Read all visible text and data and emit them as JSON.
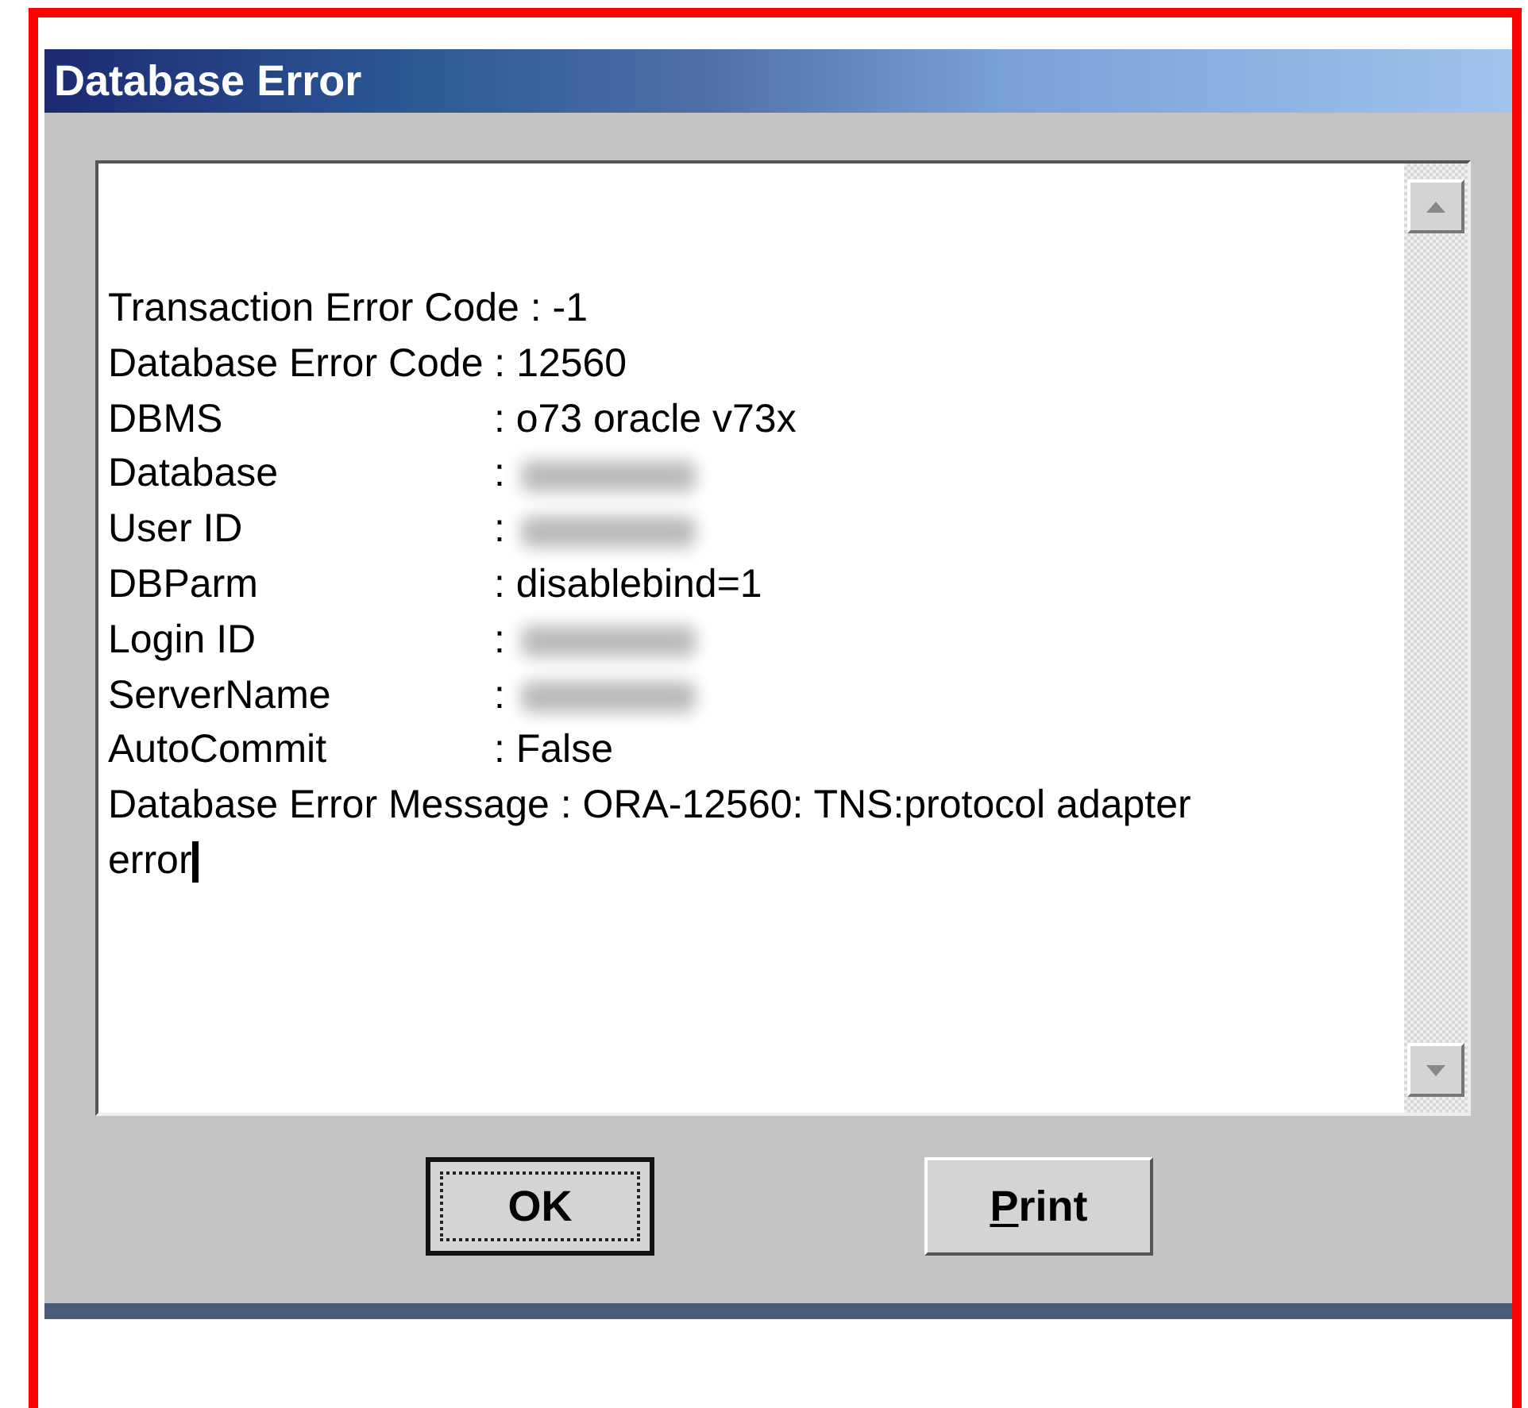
{
  "window": {
    "title": "Database Error"
  },
  "message_lines": [
    {
      "label": "Transaction Error Code",
      "value": ": -1",
      "redacted": false
    },
    {
      "label": "Database Error Code",
      "value": ": 12560",
      "redacted": false
    },
    {
      "label": "DBMS",
      "value": ": o73 oracle v73x",
      "redacted": false
    },
    {
      "label": "Database",
      "value": ":",
      "redacted": true
    },
    {
      "label": "User ID",
      "value": ":",
      "redacted": true
    },
    {
      "label": "DBParm",
      "value": ": disablebind=1",
      "redacted": false
    },
    {
      "label": "Login ID",
      "value": ":",
      "redacted": true
    },
    {
      "label": "ServerName",
      "value": ":",
      "redacted": true
    },
    {
      "label": "AutoCommit",
      "value": ": False",
      "redacted": false
    },
    {
      "label": "Database Error Message",
      "value": ": ORA-12560: TNS:protocol adapter error",
      "redacted": false
    }
  ],
  "buttons": [
    {
      "label_parts": [
        {
          "text": "OK",
          "underlined": false
        }
      ],
      "default": true
    },
    {
      "label_parts": [
        {
          "text": "P",
          "underlined": true
        },
        {
          "text": "rint",
          "underlined": false
        }
      ],
      "default": false
    }
  ]
}
